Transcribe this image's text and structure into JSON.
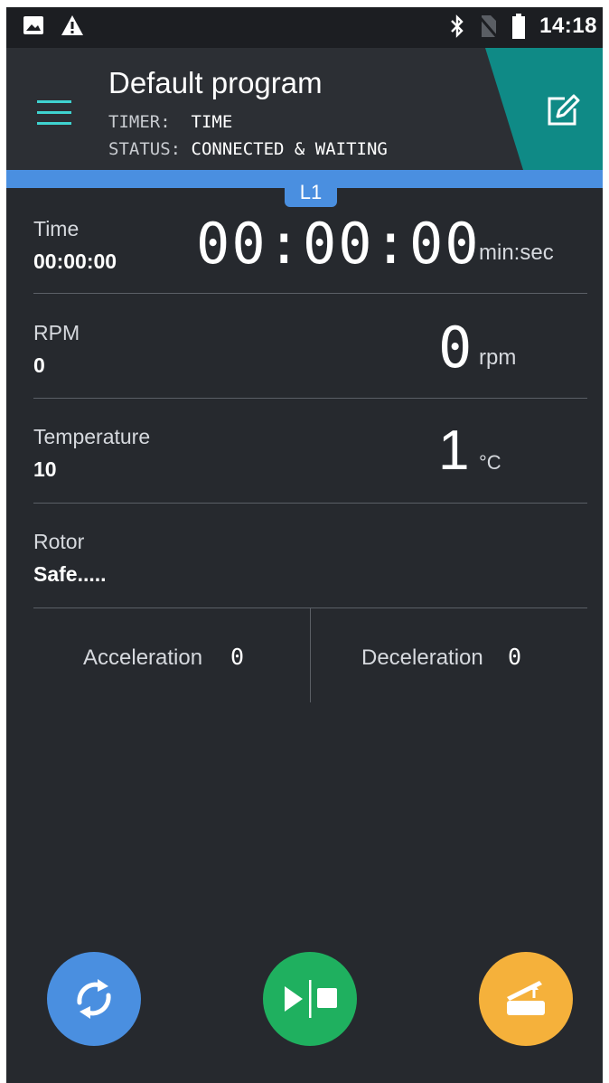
{
  "status_bar": {
    "time": "14:18",
    "icons": [
      "image-icon",
      "warning-icon",
      "bluetooth-icon",
      "no-sim-icon",
      "battery-icon"
    ]
  },
  "app_bar": {
    "title": "Default program",
    "timer_key": "TIMER:",
    "timer_value": "TIME",
    "status_key": "STATUS:",
    "status_value": "CONNECTED & WAITING",
    "accent_color": "#0f8a86"
  },
  "tab": {
    "label": "L1",
    "color": "#4a8fe0"
  },
  "rows": {
    "time": {
      "label": "Time",
      "set_value": "00:00:00",
      "display": "00:00:00",
      "unit": "min:sec"
    },
    "rpm": {
      "label": "RPM",
      "set_value": "0",
      "display": "0",
      "unit": "rpm"
    },
    "temperature": {
      "label": "Temperature",
      "set_value": "10",
      "display": "1",
      "unit": "°C"
    },
    "rotor": {
      "label": "Rotor",
      "value": "Safe....."
    }
  },
  "acceleration": {
    "label": "Acceleration",
    "value": "0"
  },
  "deceleration": {
    "label": "Deceleration",
    "value": "0"
  },
  "fabs": {
    "refresh": {
      "icon": "refresh-icon",
      "color": "#4a8fe0"
    },
    "play_stop": {
      "icon": "play-stop-icon",
      "color": "#1fb05f"
    },
    "lid": {
      "icon": "open-lid-icon",
      "color": "#f5b13b"
    }
  }
}
